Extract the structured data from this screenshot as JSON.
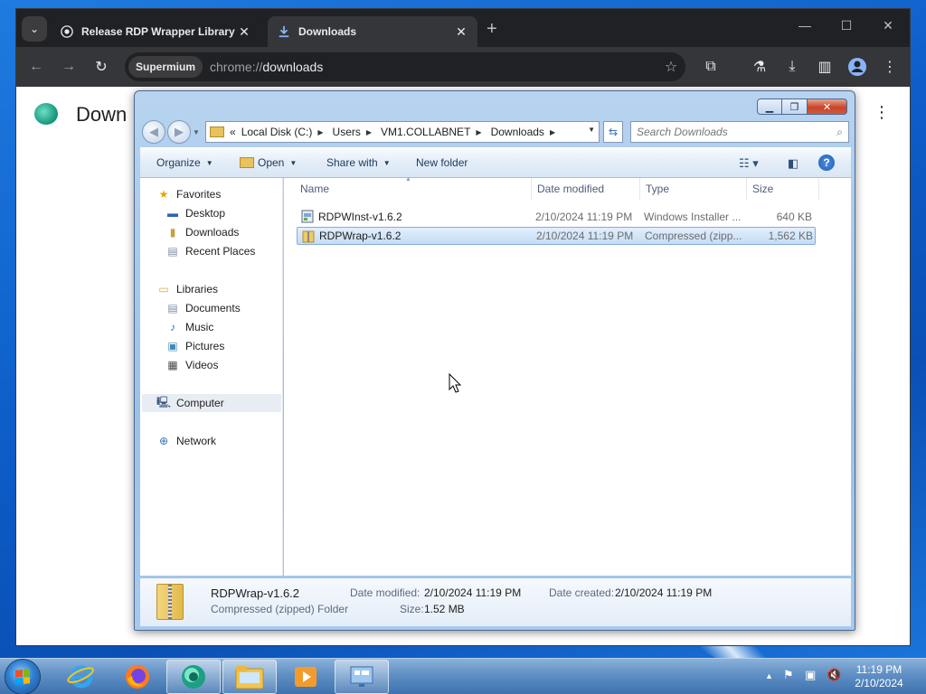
{
  "chrome": {
    "tabs": [
      {
        "label": "Release RDP Wrapper Library v"
      },
      {
        "label": "Downloads"
      }
    ],
    "site_chip": "Supermium",
    "url_scheme": "chrome://",
    "url_path": "downloads",
    "page_title": "Down"
  },
  "explorer": {
    "breadcrumb": [
      "«",
      "Local Disk (C:)",
      "Users",
      "VM1.COLLABNET",
      "Downloads"
    ],
    "search_placeholder": "Search Downloads",
    "commands": {
      "organize": "Organize",
      "open": "Open",
      "share_with": "Share with",
      "new_folder": "New folder"
    },
    "nav": {
      "favorites": "Favorites",
      "desktop": "Desktop",
      "downloads": "Downloads",
      "recent_places": "Recent Places",
      "libraries": "Libraries",
      "documents": "Documents",
      "music": "Music",
      "pictures": "Pictures",
      "videos": "Videos",
      "computer": "Computer",
      "network": "Network"
    },
    "columns": {
      "name": "Name",
      "date_modified": "Date modified",
      "type": "Type",
      "size": "Size"
    },
    "files": [
      {
        "name": "RDPWInst-v1.6.2",
        "date": "2/10/2024 11:19 PM",
        "type": "Windows Installer ...",
        "size": "640 KB"
      },
      {
        "name": "RDPWrap-v1.6.2",
        "date": "2/10/2024 11:19 PM",
        "type": "Compressed (zipp...",
        "size": "1,562 KB"
      }
    ],
    "details": {
      "name": "RDPWrap-v1.6.2",
      "kind": "Compressed (zipped) Folder",
      "date_modified_label": "Date modified:",
      "date_modified": "2/10/2024 11:19 PM",
      "date_created_label": "Date created:",
      "date_created": "2/10/2024 11:19 PM",
      "size_label": "Size:",
      "size": "1.52 MB"
    }
  },
  "taskbar": {
    "time": "11:19 PM",
    "date": "2/10/2024"
  },
  "colors": {
    "chrome_dark": "#202124",
    "selection": "#c4ddf6",
    "desktop_blue": "#0d5cc8"
  }
}
